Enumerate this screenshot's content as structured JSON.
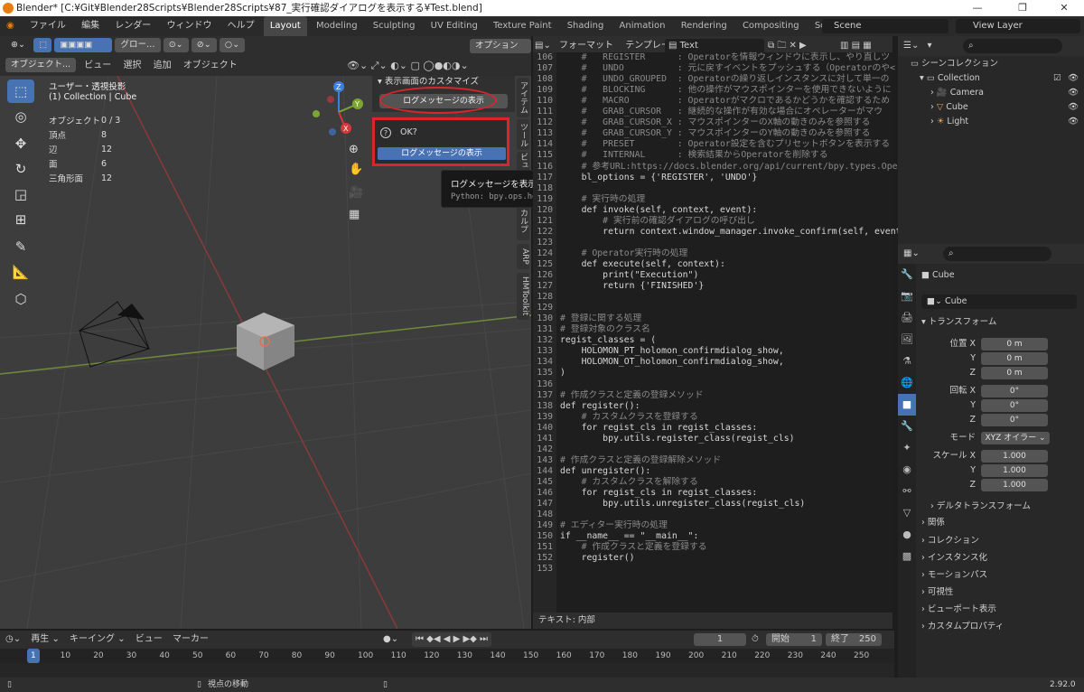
{
  "titlebar": {
    "text": "Blender* [C:¥Git¥Blender28Scripts¥Blender28Scripts¥87_実行確認ダイアログを表示する¥Test.blend]",
    "min": "—",
    "max": "❐",
    "close": "✕"
  },
  "menu": {
    "items": [
      "ファイル",
      "編集",
      "レンダー",
      "ウィンドウ",
      "ヘルプ"
    ],
    "tabs": [
      "Layout",
      "Modeling",
      "Sculpting",
      "UV Editing",
      "Texture Paint",
      "Shading",
      "Animation",
      "Rendering",
      "Compositing",
      "Scripting"
    ],
    "add": "+",
    "scene": "Scene",
    "view_layer": "View Layer"
  },
  "viewport_header": {
    "transform": "グロー…",
    "options": "オプション ⌄",
    "mode": "オブジェクト...",
    "menus": [
      "ビュー",
      "選択",
      "追加",
      "オブジェクト"
    ]
  },
  "viewport": {
    "view_name": "ユーザー・透視投影",
    "collection": "(1) Collection | Cube",
    "stats": [
      [
        "オブジェクト",
        "0 / 3"
      ],
      [
        "頂点",
        "8"
      ],
      [
        "辺",
        "12"
      ],
      [
        "面",
        "6"
      ],
      [
        "三角形面",
        "12"
      ]
    ]
  },
  "npanel": {
    "title": "表示画面のカスタマイズ",
    "button": "ログメッセージの表示",
    "tabs": [
      "アイテム",
      "ツール",
      "ビュー",
      "スカルプ",
      "ARP",
      "HMToolkit"
    ]
  },
  "dialog": {
    "question": "OK?",
    "button": "ログメッセージの表示"
  },
  "tooltip": {
    "text": "ログメッセージを表示します。",
    "python": "Python: bpy.ops.holomon.confirmdialog_show()"
  },
  "text_editor": {
    "menus": [
      "フォーマット",
      "テンプレート"
    ],
    "name": "Text",
    "status": "テキスト: 内部"
  },
  "code_lines": [
    [
      "106",
      "    #   REGISTER      : Operatorを情報ウィンドウに表示し、やり直しツ",
      "cm"
    ],
    [
      "107",
      "    #   UNDO          : 元に戻すイベントをプッシュする（Operatorのや<",
      "cm"
    ],
    [
      "108",
      "    #   UNDO_GROUPED  : Operatorの繰り返しインスタンスに対して単一の",
      "cm"
    ],
    [
      "109",
      "    #   BLOCKING      : 他の操作がマウスポインターを使用できないように",
      "cm"
    ],
    [
      "110",
      "    #   MACRO         : Operatorがマクロであるかどうかを確認するため",
      "cm"
    ],
    [
      "111",
      "    #   GRAB_CURSOR   : 継続的な操作が有効な場合にオペレーターがマウ",
      "cm"
    ],
    [
      "112",
      "    #   GRAB_CURSOR_X : マウスポインターのX軸の動きのみを参照する",
      "cm"
    ],
    [
      "113",
      "    #   GRAB_CURSOR_Y : マウスポインターのY軸の動きのみを参照する",
      "cm"
    ],
    [
      "114",
      "    #   PRESET        : Operator設定を含むプリセットボタンを表示する",
      "cm"
    ],
    [
      "115",
      "    #   INTERNAL      : 検索結果からOperatorを削除する",
      "cm"
    ],
    [
      "116",
      "    # 参考URL:https://docs.blender.org/api/current/bpy.types.Operato",
      "cm"
    ],
    [
      "117",
      "    bl_options = {'REGISTER', 'UNDO'}",
      "t"
    ],
    [
      "118",
      "",
      "t"
    ],
    [
      "119",
      "    # 実行時の処理",
      "cm"
    ],
    [
      "120",
      "    def invoke(self, context, event):",
      "t"
    ],
    [
      "121",
      "        # 実行前の確認ダイアログの呼び出し",
      "cm"
    ],
    [
      "122",
      "        return context.window_manager.invoke_confirm(self, event)",
      "t"
    ],
    [
      "123",
      "",
      "t"
    ],
    [
      "124",
      "    # Operator実行時の処理",
      "cm"
    ],
    [
      "125",
      "    def execute(self, context):",
      "t"
    ],
    [
      "126",
      "        print(\"Execution\")",
      "t"
    ],
    [
      "127",
      "        return {'FINISHED'}",
      "t"
    ],
    [
      "128",
      "",
      "t"
    ],
    [
      "129",
      "",
      "t"
    ],
    [
      "130",
      "# 登録に関する処理",
      "cm"
    ],
    [
      "131",
      "# 登録対象のクラス名",
      "cm"
    ],
    [
      "132",
      "regist_classes = (",
      "t"
    ],
    [
      "133",
      "    HOLOMON_PT_holomon_confirmdialog_show,",
      "t"
    ],
    [
      "134",
      "    HOLOMON_OT_holomon_confirmdialog_show,",
      "t"
    ],
    [
      "135",
      ")",
      "t"
    ],
    [
      "136",
      "",
      "t"
    ],
    [
      "137",
      "# 作成クラスと定義の登録メソッド",
      "cm"
    ],
    [
      "138",
      "def register():",
      "t"
    ],
    [
      "139",
      "    # カスタムクラスを登録する",
      "cm"
    ],
    [
      "140",
      "    for regist_cls in regist_classes:",
      "t"
    ],
    [
      "141",
      "        bpy.utils.register_class(regist_cls)",
      "t"
    ],
    [
      "142",
      "",
      "t"
    ],
    [
      "143",
      "# 作成クラスと定義の登録解除メソッド",
      "cm"
    ],
    [
      "144",
      "def unregister():",
      "t"
    ],
    [
      "145",
      "    # カスタムクラスを解除する",
      "cm"
    ],
    [
      "146",
      "    for regist_cls in regist_classes:",
      "t"
    ],
    [
      "147",
      "        bpy.utils.unregister_class(regist_cls)",
      "t"
    ],
    [
      "148",
      "",
      "t"
    ],
    [
      "149",
      "# エディター実行時の処理",
      "cm"
    ],
    [
      "150",
      "if __name__ == \"__main__\":",
      "t"
    ],
    [
      "151",
      "    # 作成クラスと定義を登録する",
      "cm"
    ],
    [
      "152",
      "    register()",
      "t"
    ],
    [
      "153",
      "",
      "t"
    ]
  ],
  "outliner": {
    "scene_collection": "シーンコレクション",
    "items": [
      "Collection",
      "Camera",
      "Cube",
      "Light"
    ]
  },
  "properties": {
    "object_name": "Cube",
    "data_name": "Cube",
    "section": "トランスフォーム",
    "location_label": "位置 X",
    "rotation_label": "回転 X",
    "scale_label": "スケール X",
    "y": "Y",
    "z": "Z",
    "location": [
      "0 m",
      "0 m",
      "0 m"
    ],
    "rotation": [
      "0°",
      "0°",
      "0°"
    ],
    "scale": [
      "1.000",
      "1.000",
      "1.000"
    ],
    "mode_label": "モード",
    "mode": "XYZ オイラー",
    "delta": "デルタトランスフォーム",
    "panels": [
      "関係",
      "コレクション",
      "インスタンス化",
      "モーションパス",
      "可視性",
      "ビューポート表示",
      "カスタムプロパティ"
    ]
  },
  "timeline": {
    "menus": [
      "再生 ⌄",
      "キーイング ⌄",
      "ビュー",
      "マーカー"
    ],
    "current": "1",
    "start_label": "開始",
    "start": "1",
    "end_label": "終了",
    "end": "250",
    "ticks": [
      "1",
      "10",
      "20",
      "30",
      "40",
      "50",
      "60",
      "70",
      "80",
      "90",
      "100",
      "110",
      "120",
      "130",
      "140",
      "150",
      "160",
      "170",
      "180",
      "190",
      "200",
      "210",
      "220",
      "230",
      "240",
      "250"
    ]
  },
  "status": {
    "hint": "視点の移動",
    "version": "2.92.0"
  },
  "colors": {
    "accent": "#4772b3",
    "highlight_red": "#d9262b"
  }
}
